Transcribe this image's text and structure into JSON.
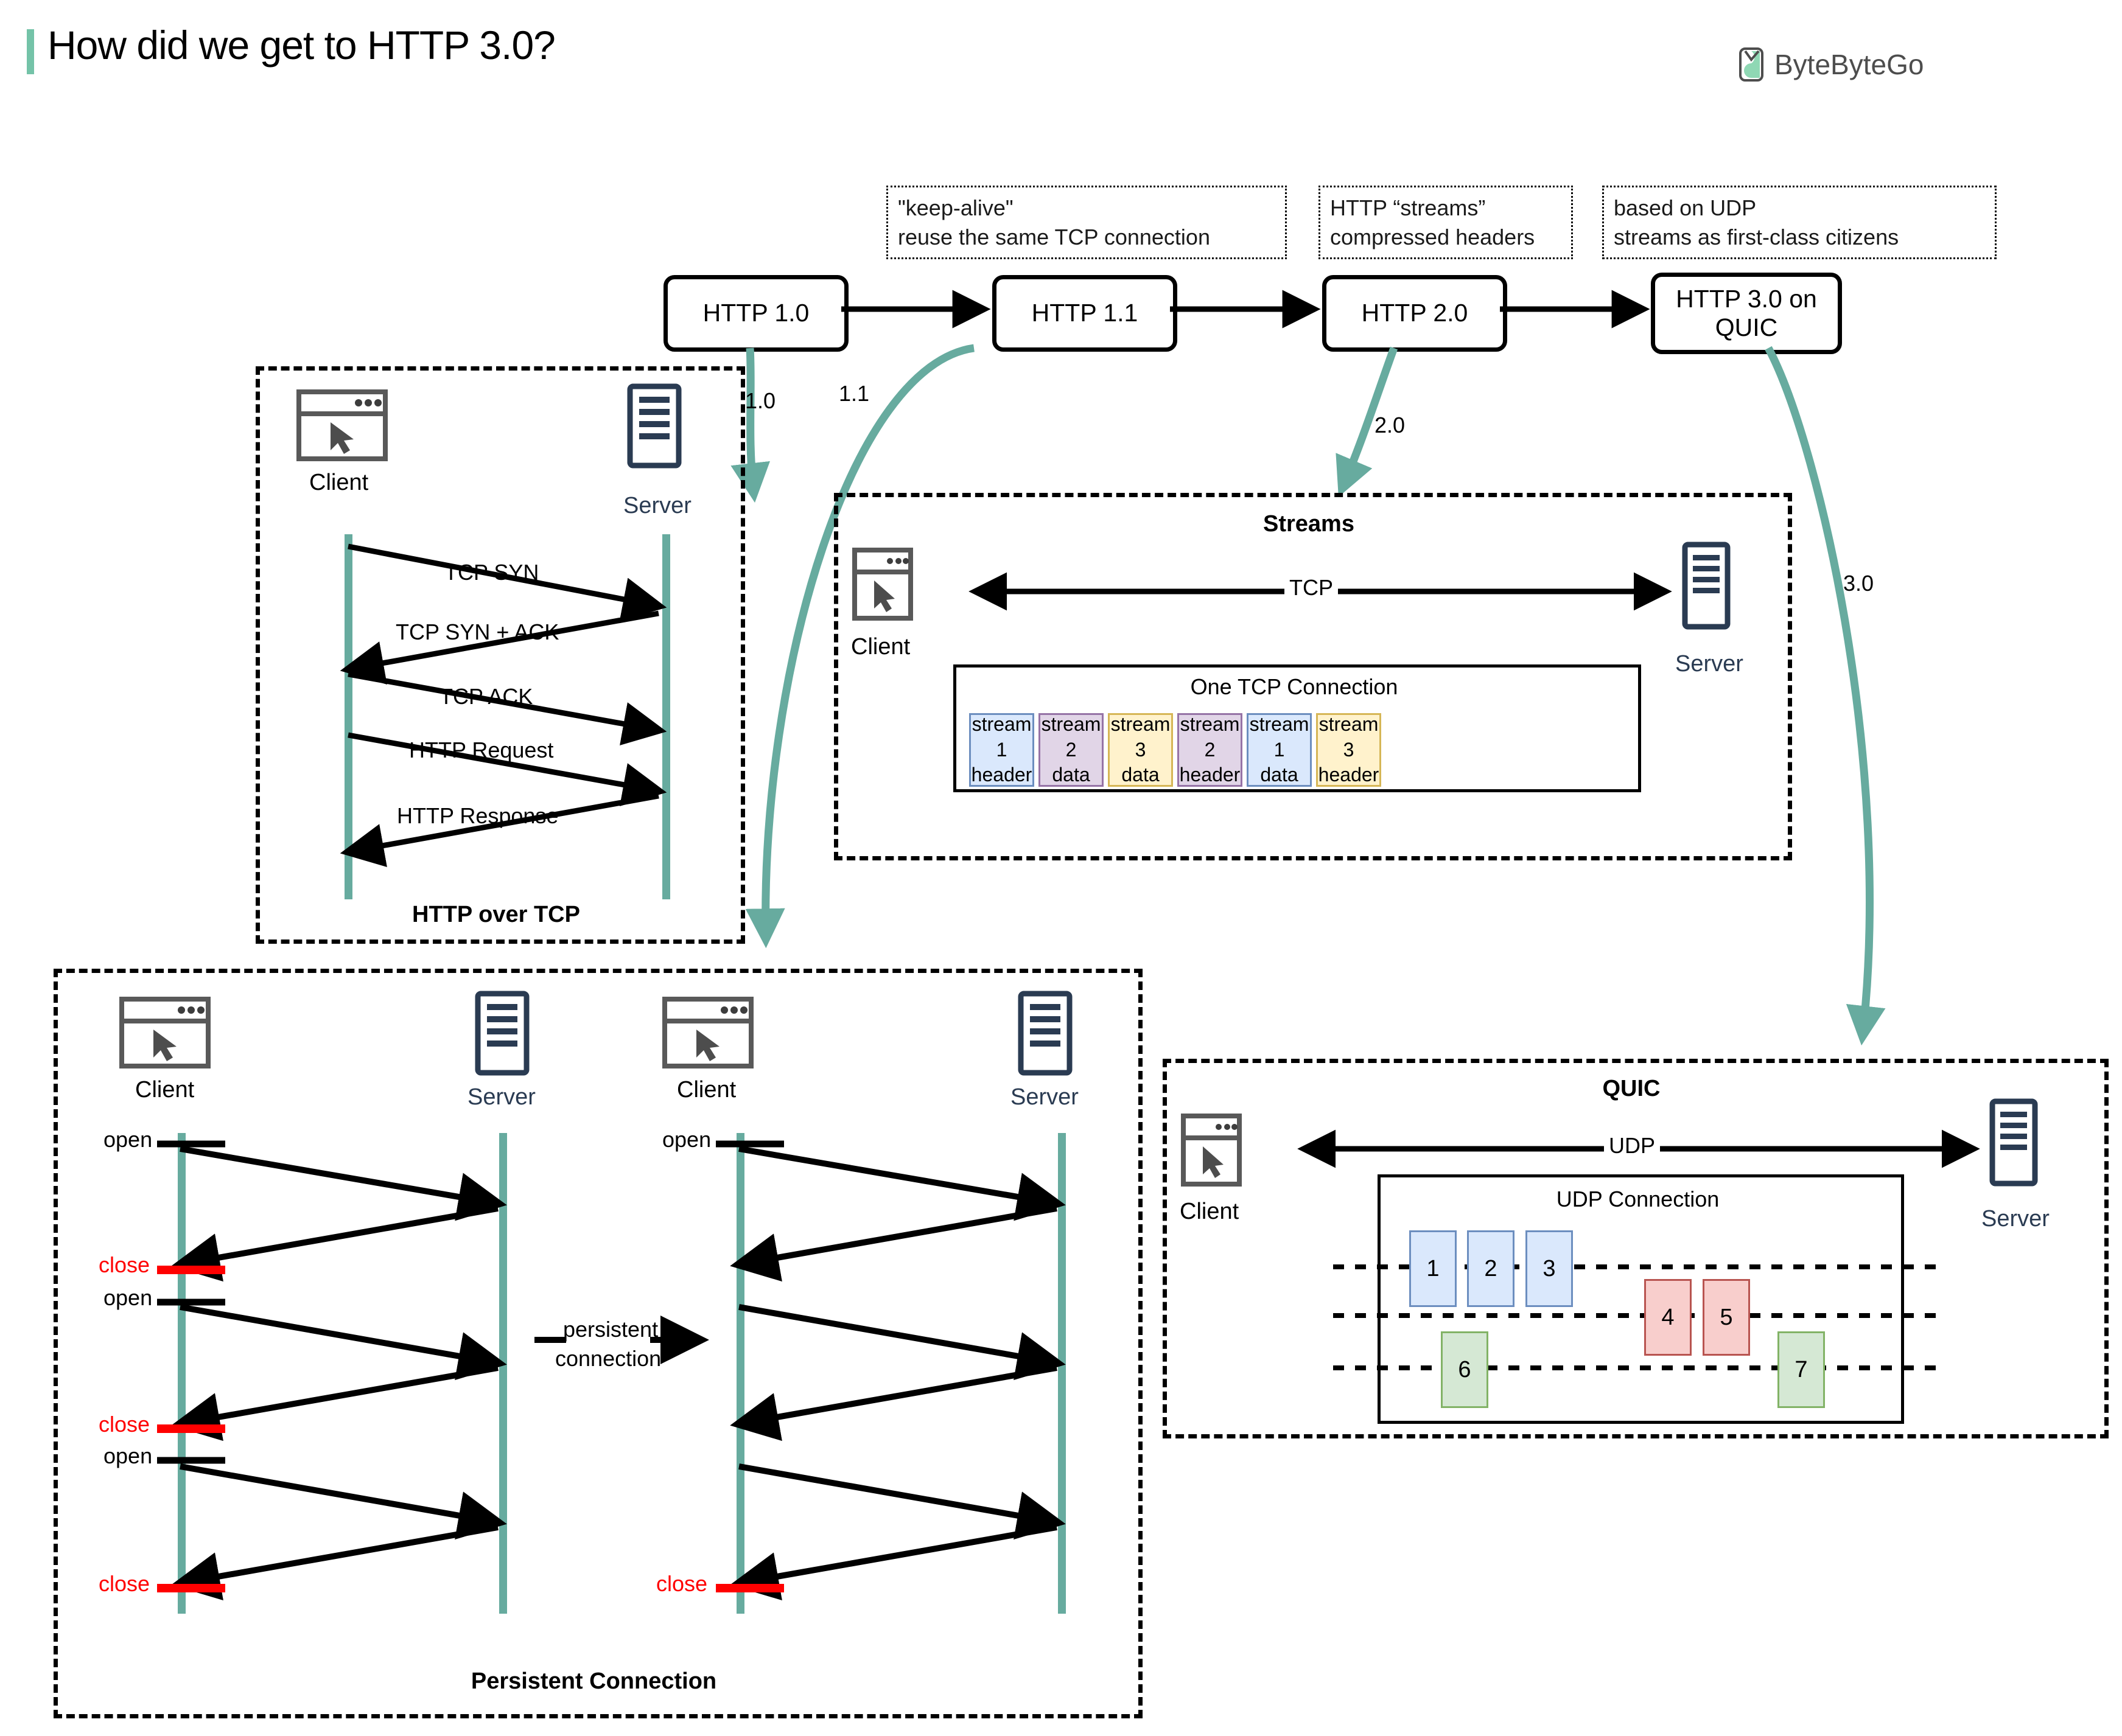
{
  "header": {
    "title": "How did we get to HTTP 3.0?",
    "logo_text": "ByteByteGo",
    "accent_color": "#74c3a8"
  },
  "timeline": {
    "versions": [
      {
        "id": "http10",
        "label": "HTTP 1.0"
      },
      {
        "id": "http11",
        "label": "HTTP 1.1"
      },
      {
        "id": "http20",
        "label": "HTTP 2.0"
      },
      {
        "id": "http30",
        "label": "HTTP 3.0 on QUIC",
        "line1": "HTTP 3.0 on",
        "line2": "QUIC"
      }
    ],
    "notes": [
      {
        "id": "note-keep-alive",
        "line1": "\"keep-alive\"",
        "line2": "reuse the same TCP connection"
      },
      {
        "id": "note-streams",
        "line1": "HTTP “streams”",
        "line2": "compressed headers"
      },
      {
        "id": "note-udp",
        "line1": "based on UDP",
        "line2": "streams as first-class citizens"
      }
    ],
    "connector_labels": [
      "1.0",
      "1.1",
      "2.0",
      "3.0"
    ]
  },
  "panel_http_over_tcp": {
    "title": "HTTP over TCP",
    "client_label": "Client",
    "server_label": "Server",
    "messages": [
      {
        "text": "TCP SYN",
        "direction": "right"
      },
      {
        "text": "TCP SYN + ACK",
        "direction": "left"
      },
      {
        "text": "TCP ACK",
        "direction": "right"
      },
      {
        "text": "HTTP Request",
        "direction": "right"
      },
      {
        "text": "HTTP Response",
        "direction": "left"
      }
    ]
  },
  "panel_streams": {
    "title": "Streams",
    "client_label": "Client",
    "server_label": "Server",
    "transport_label": "TCP",
    "connection_title": "One TCP Connection",
    "chips": [
      {
        "line1": "stream 1",
        "line2": "header",
        "fill": "#dae8fc",
        "stroke": "#6c8ebf"
      },
      {
        "line1": "stream 2",
        "line2": "data",
        "fill": "#e1d5e7",
        "stroke": "#9673a6"
      },
      {
        "line1": "stream 3",
        "line2": "data",
        "fill": "#fff2cc",
        "stroke": "#d6b656"
      },
      {
        "line1": "stream 2",
        "line2": "header",
        "fill": "#e1d5e7",
        "stroke": "#9673a6"
      },
      {
        "line1": "stream 1",
        "line2": "data",
        "fill": "#dae8fc",
        "stroke": "#6c8ebf"
      },
      {
        "line1": "stream 3",
        "line2": "header",
        "fill": "#fff2cc",
        "stroke": "#d6b656"
      }
    ]
  },
  "panel_quic": {
    "title": "QUIC",
    "client_label": "Client",
    "server_label": "Server",
    "transport_label": "UDP",
    "connection_title": "UDP Connection",
    "packets": [
      {
        "label": "1",
        "fill": "#dae8fc",
        "stroke": "#6c8ebf",
        "row": 1
      },
      {
        "label": "2",
        "fill": "#dae8fc",
        "stroke": "#6c8ebf",
        "row": 1
      },
      {
        "label": "3",
        "fill": "#dae8fc",
        "stroke": "#6c8ebf",
        "row": 1
      },
      {
        "label": "4",
        "fill": "#f8cecc",
        "stroke": "#b85450",
        "row": 2
      },
      {
        "label": "5",
        "fill": "#f8cecc",
        "stroke": "#b85450",
        "row": 2
      },
      {
        "label": "6",
        "fill": "#d5e8d4",
        "stroke": "#82b366",
        "row": 3
      },
      {
        "label": "7",
        "fill": "#d5e8d4",
        "stroke": "#82b366",
        "row": 3
      }
    ]
  },
  "panel_persistent": {
    "title": "Persistent Connection",
    "middle_label_line1": "persistent",
    "middle_label_line2": "connection",
    "left": {
      "client_label": "Client",
      "server_label": "Server",
      "markers": [
        {
          "text": "open",
          "kind": "open"
        },
        {
          "text": "close",
          "kind": "close"
        },
        {
          "text": "open",
          "kind": "open"
        },
        {
          "text": "close",
          "kind": "close"
        },
        {
          "text": "open",
          "kind": "open"
        },
        {
          "text": "close",
          "kind": "close"
        }
      ]
    },
    "right": {
      "client_label": "Client",
      "server_label": "Server",
      "markers": [
        {
          "text": "open",
          "kind": "open"
        },
        {
          "text": "close",
          "kind": "close"
        }
      ]
    }
  },
  "colors": {
    "teal": "#67ab9f",
    "server_ink": "#2a3b52",
    "client_ink": "#595959",
    "red": "#ff0000"
  }
}
